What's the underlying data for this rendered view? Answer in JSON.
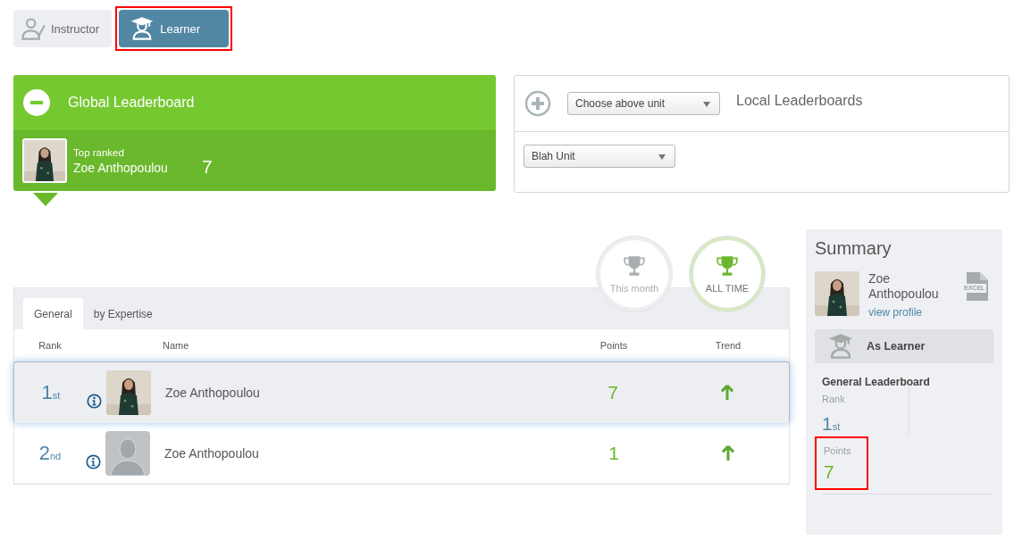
{
  "role_tabs": [
    {
      "label": "Instructor",
      "selected": false,
      "highlighted": false
    },
    {
      "label": "Learner",
      "selected": true,
      "highlighted": true
    }
  ],
  "global_leaderboard": {
    "title": "Global Leaderboard",
    "expanded": true,
    "top_label": "Top ranked",
    "top_name": "Zoe Anthopoulou",
    "top_points": "7"
  },
  "local_leaderboards": {
    "title": "Local Leaderboards",
    "expanded": false,
    "unit_select": "Choose above unit",
    "sub_select": "Blah Unit"
  },
  "period_toggles": [
    {
      "label": "This month",
      "selected": false
    },
    {
      "label": "ALL TIME",
      "selected": true
    }
  ],
  "table_tabs": [
    {
      "label": "General",
      "selected": true
    },
    {
      "label": "by Expertise",
      "selected": false
    }
  ],
  "columns": [
    "Rank",
    "Name",
    "Points",
    "Trend"
  ],
  "rows": [
    {
      "rank": "1$_{st}$",
      "name": "Zoe Anthopoulou",
      "points": "7",
      "trend": {
        "kind": "up"
      },
      "selected": true
    },
    {
      "rank": "2$_{nd}$",
      "avatar": {
        "kind": "placeholder"
      },
      "name": "Zoe Anthopoulou",
      "points": "1",
      "trend": {
        "kind": "up"
      },
      "selected": false
    }
  ],
  "summary": {
    "title": "Summary",
    "name": "Zoe Anthopoulou",
    "profile_link": "view profile",
    "export_label": "EXCEL",
    "role": "As Learner",
    "board": "General Leaderboard",
    "stats": [
      {
        "label": "Rank",
        "value": "1$_{st}$",
        "highlighted": false
      },
      {
        "label": "Points",
        "value": "7",
        "highlighted": true
      }
    ]
  }
}
